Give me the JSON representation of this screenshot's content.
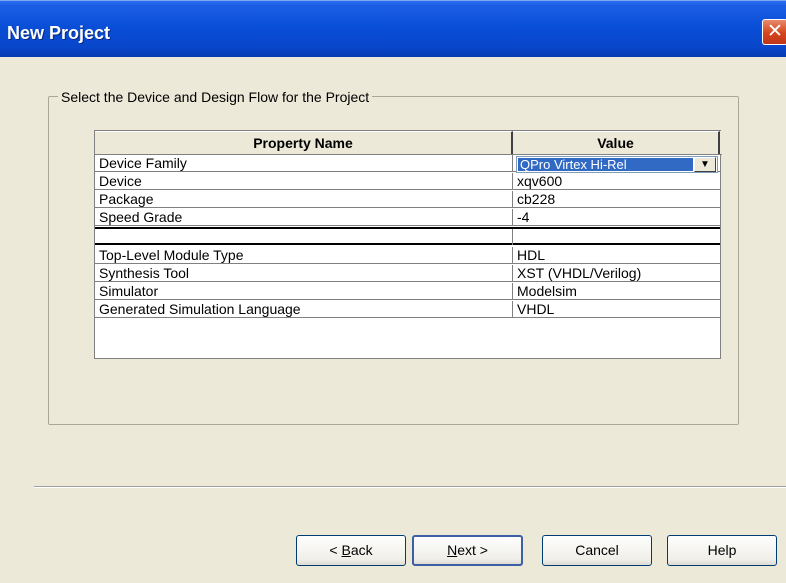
{
  "window": {
    "title": "New Project",
    "close_label": "✕"
  },
  "group": {
    "label": "Select the Device and Design Flow for the Project"
  },
  "grid": {
    "headers": {
      "name": "Property Name",
      "value": "Value"
    },
    "rows": [
      {
        "name": "Device Family",
        "value": "QPro Virtex Hi-Rel"
      },
      {
        "name": "Device",
        "value": "xqv600"
      },
      {
        "name": "Package",
        "value": "cb228"
      },
      {
        "name": "Speed Grade",
        "value": "-4"
      },
      {
        "name": "",
        "value": ""
      },
      {
        "name": "Top-Level Module Type",
        "value": "HDL"
      },
      {
        "name": "Synthesis Tool",
        "value": "XST (VHDL/Verilog)"
      },
      {
        "name": "Simulator",
        "value": "Modelsim"
      },
      {
        "name": "Generated Simulation Language",
        "value": "VHDL"
      }
    ]
  },
  "buttons": {
    "back_prefix": "< ",
    "back_u": "B",
    "back_rest": "ack",
    "next_u": "N",
    "next_rest": "ext >",
    "cancel": "Cancel",
    "help": "Help"
  },
  "icons": {
    "dropdown": "chevron-down-icon",
    "close": "close-icon"
  },
  "colors": {
    "titlebar": "#0a4fd8",
    "selection": "#316ac5",
    "close": "#d3451c"
  }
}
